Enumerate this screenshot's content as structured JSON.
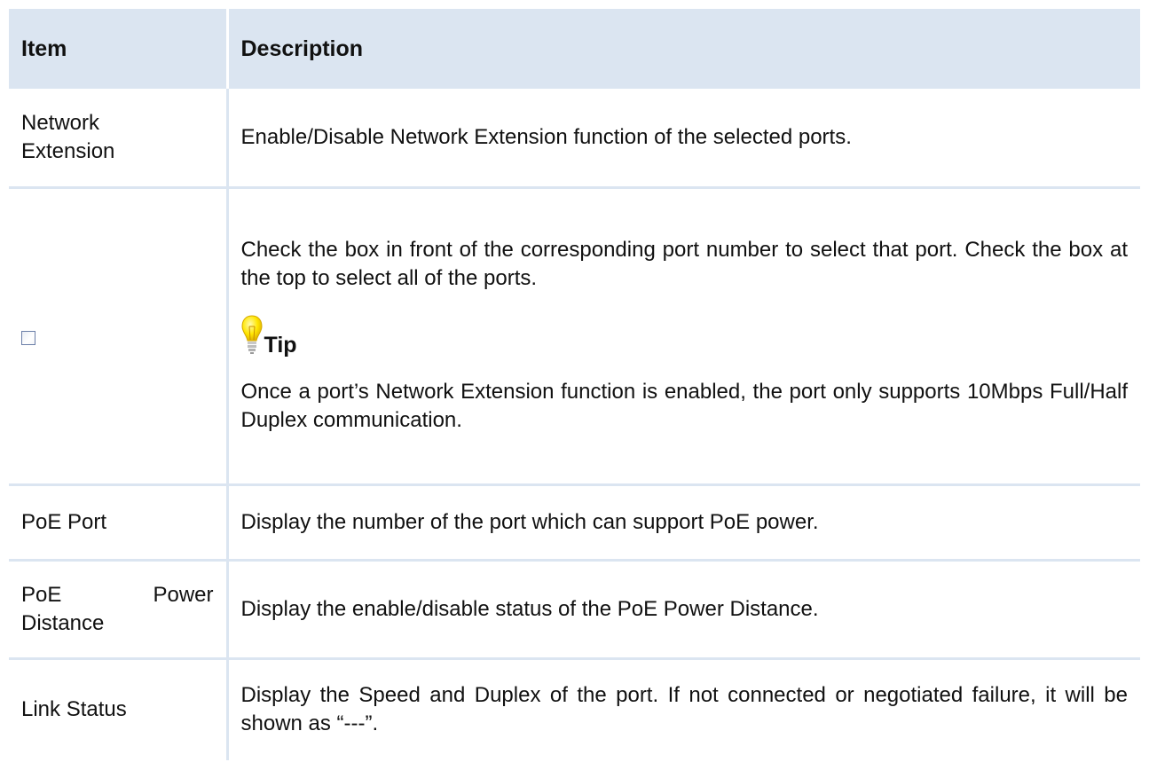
{
  "table": {
    "headers": {
      "item": "Item",
      "description": "Description"
    },
    "rows": [
      {
        "item": "Network Extension",
        "description": "Enable/Disable Network Extension function of the selected ports."
      },
      {
        "item_icon": "checkbox-icon",
        "description": "Check the box in front of the corresponding port number to select that port. Check the box at the top to select all of the ports.",
        "tip": {
          "icon": "lightbulb-icon",
          "label": "Tip",
          "text": "Once a port’s Network Extension function is enabled, the port only supports 10Mbps Full/Half Duplex communication."
        }
      },
      {
        "item": "PoE Port",
        "description": "Display the number of the port which can support PoE power."
      },
      {
        "item": "PoE Power Distance",
        "description": "Display the enable/disable status of the PoE Power Distance."
      },
      {
        "item": "Link Status",
        "description": "Display the Speed and Duplex of the port. If not connected or negotiated failure, it will be shown as “---”."
      }
    ]
  },
  "colors": {
    "header_bg": "#dbe5f1",
    "rule": "#dbe5f1",
    "bulb": "#ffe600"
  }
}
